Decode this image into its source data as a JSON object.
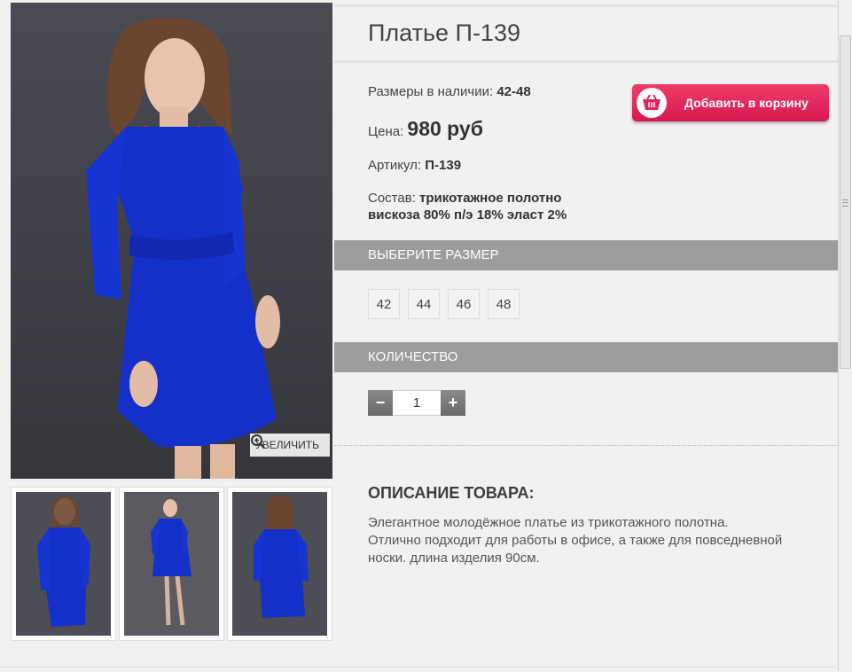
{
  "product": {
    "title": "Платье П-139",
    "sizes_label": "Размеры в наличии:",
    "sizes_value": "42-48",
    "price_label": "Цена:",
    "price_value": "980 руб",
    "article_label": "Артикул:",
    "article_value": "П-139",
    "composition_label": "Состав:",
    "composition_line1": "трикотажное полотно",
    "composition_line2": "вискоза 80% п/э 18% эласт 2%"
  },
  "cart_button": {
    "label": "Добавить в корзину",
    "icon": "basket-icon"
  },
  "gallery": {
    "zoom_label": "УВЕЛИЧИТЬ",
    "zoom_icon": "magnifier-plus-icon",
    "thumbnail_count": 3
  },
  "size_section": {
    "header": "ВЫБЕРИТЕ РАЗМЕР",
    "options": [
      "42",
      "44",
      "46",
      "48"
    ]
  },
  "quantity_section": {
    "header": "КОЛИЧЕСТВО",
    "minus": "−",
    "value": "1",
    "plus": "+"
  },
  "description": {
    "heading": "ОПИСАНИЕ ТОВАРА:",
    "text": "Элегантное молодёжное платье из трикотажного полотна. Отлично подходит для работы в офисе, а также для повседневной носки. длина изделия 90см."
  },
  "colors": {
    "accent": "#e0245a",
    "dress": "#1530c8",
    "section_bar": "#9c9c9e"
  }
}
